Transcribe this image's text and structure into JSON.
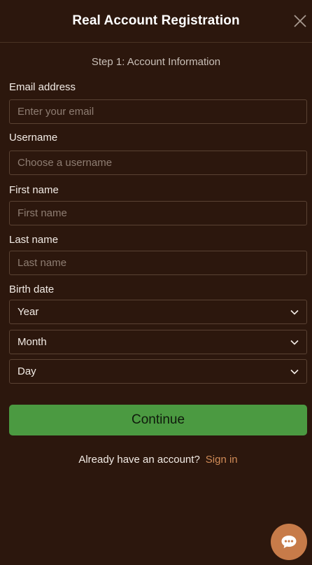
{
  "header": {
    "title": "Real Account Registration"
  },
  "step": "Step 1: Account Information",
  "fields": {
    "email": {
      "label": "Email address",
      "placeholder": "Enter your email",
      "value": ""
    },
    "username": {
      "label": "Username",
      "placeholder": "Choose a username",
      "value": ""
    },
    "first_name": {
      "label": "First name",
      "placeholder": "First name",
      "value": ""
    },
    "last_name": {
      "label": "Last name",
      "placeholder": "Last name",
      "value": ""
    }
  },
  "birth_date": {
    "label": "Birth date",
    "year": "Year",
    "month": "Month",
    "day": "Day"
  },
  "actions": {
    "continue_label": "Continue"
  },
  "signin": {
    "prompt": "Already have an account?",
    "link": "Sign in"
  },
  "icons": {
    "close": "close-icon",
    "chevron": "chevron-down-icon",
    "chat": "chat-bubble-icon"
  },
  "colors": {
    "background": "#2c170d",
    "primary_button": "#4b9a41",
    "link": "#d08b57",
    "chat_button": "#c77b49"
  }
}
